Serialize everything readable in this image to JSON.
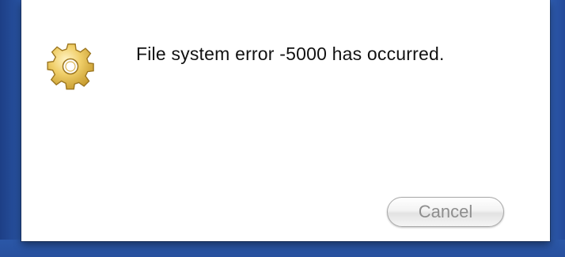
{
  "dialog": {
    "message": "File system error -5000 has occurred.",
    "icon": "gear-icon",
    "cancel_label": "Cancel"
  },
  "colors": {
    "desktop_blue": "#2a57a8",
    "dialog_background": "#ffffff",
    "gear_gold": "#e8c35a"
  }
}
